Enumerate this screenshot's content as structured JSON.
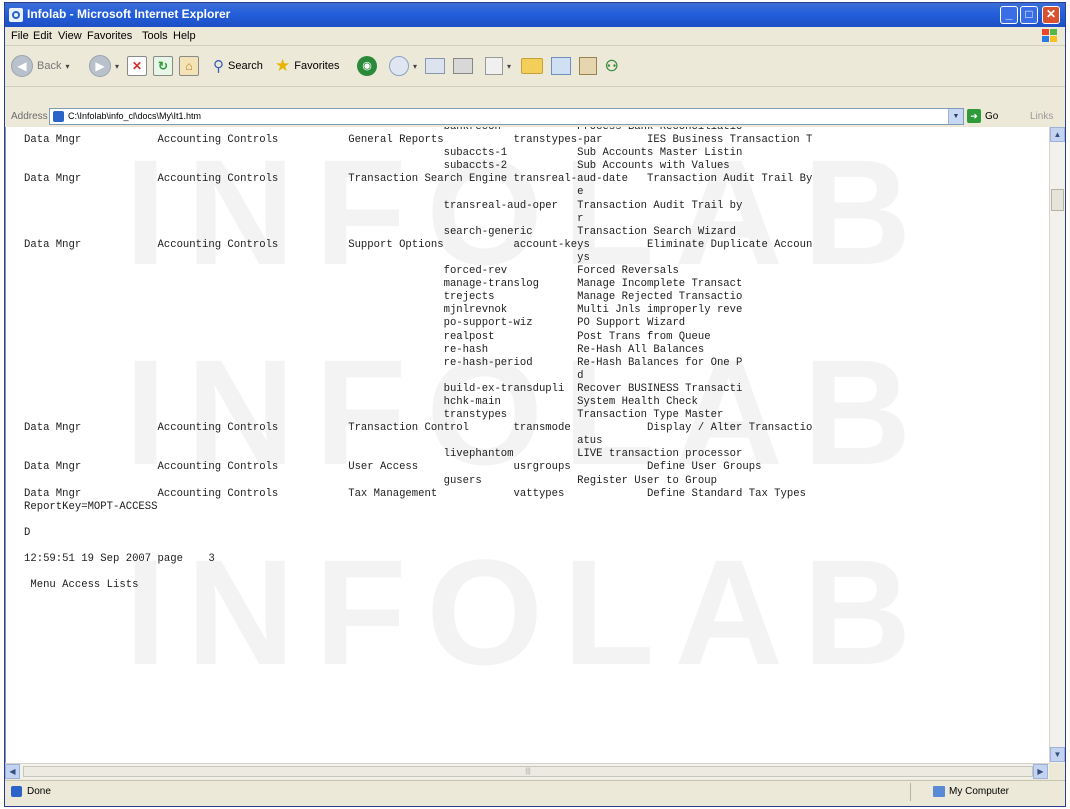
{
  "window": {
    "title": "Infolab - Microsoft Internet Explorer",
    "minimize_glyph": "_",
    "maximize_glyph": "□",
    "close_glyph": "✕"
  },
  "menu": {
    "items": [
      "File",
      "Edit",
      "View",
      "Favorites",
      "Tools",
      "Help"
    ]
  },
  "toolbar": {
    "back_label": "Back",
    "search_label": "Search",
    "favorites_label": "Favorites",
    "icons": [
      "back-icon",
      "forward-icon",
      "stop-icon",
      "refresh-icon",
      "home-icon",
      "search-icon",
      "favorites-icon",
      "media-icon",
      "history-icon",
      "mail-icon",
      "print-icon",
      "edit-icon",
      "folder-icon",
      "messenger-icon",
      "research-icon",
      "people-icon"
    ]
  },
  "address": {
    "label": "Address",
    "value": "C:\\Infolab\\info_cl\\docs\\My\\It1.htm",
    "go_label": "Go",
    "links_label": "Links"
  },
  "watermark": {
    "text": "INFOLAB"
  },
  "report": {
    "lines": [
      "                                                                  bankrecon            Process Bank Reconciliatio",
      "Data Mngr            Accounting Controls           General Reports           transtypes-par       IES Business Transaction T",
      "                                                                  subaccts-1           Sub Accounts Master Listin",
      "                                                                  subaccts-2           Sub Accounts with Values",
      "Data Mngr            Accounting Controls           Transaction Search Engine transreal-aud-date   Transaction Audit Trail By",
      "                                                                                       e",
      "                                                                  transreal-aud-oper   Transaction Audit Trail by",
      "                                                                                       r",
      "                                                                  search-generic       Transaction Search Wizard",
      "Data Mngr            Accounting Controls           Support Options           account-keys         Eliminate Duplicate Accoun",
      "                                                                                       ys",
      "                                                                  forced-rev           Forced Reversals",
      "                                                                  manage-translog      Manage Incomplete Transact",
      "                                                                  trejects             Manage Rejected Transactio",
      "                                                                  mjnlrevnok           Multi Jnls improperly reve",
      "                                                                  po-support-wiz       PO Support Wizard",
      "                                                                  realpost             Post Trans from Queue",
      "                                                                  re-hash              Re-Hash All Balances",
      "                                                                  re-hash-period       Re-Hash Balances for One P",
      "                                                                                       d",
      "                                                                  build-ex-transdupli  Recover BUSINESS Transacti",
      "                                                                  hchk-main            System Health Check",
      "                                                                  transtypes           Transaction Type Master",
      "Data Mngr            Accounting Controls           Transaction Control       transmode            Display / Alter Transactio",
      "                                                                                       atus",
      "                                                                  livephantom          LIVE transaction processor",
      "Data Mngr            Accounting Controls           User Access               usrgroups            Define User Groups",
      "                                                                  gusers               Register User to Group",
      "Data Mngr            Accounting Controls           Tax Management            vattypes             Define Standard Tax Types",
      "ReportKey=MOPT-ACCESS",
      "",
      "D",
      "",
      "12:59:51 19 Sep 2007 page    3",
      "",
      " Menu Access Lists"
    ]
  },
  "status": {
    "text": "Done",
    "zone": "My Computer"
  }
}
